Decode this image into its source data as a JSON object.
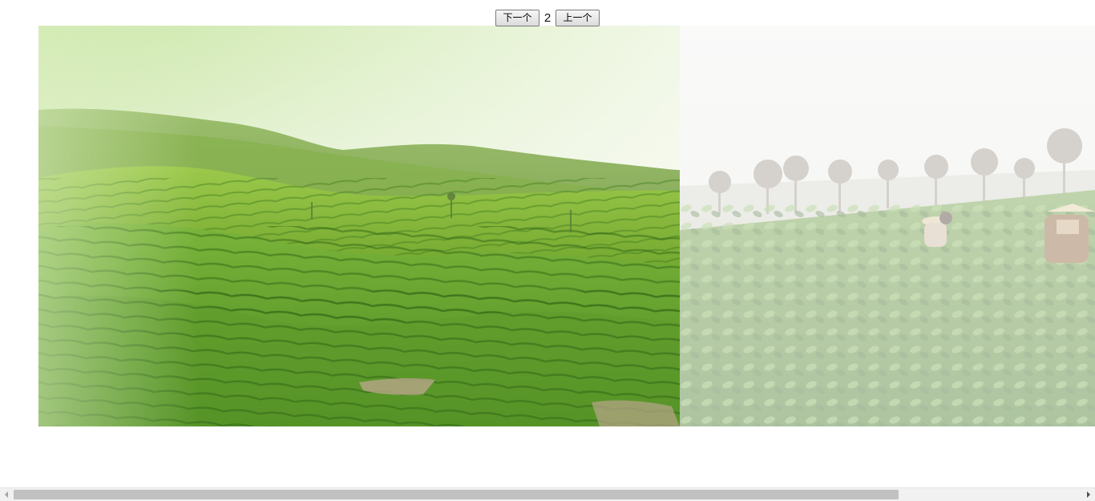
{
  "controls": {
    "next_label": "下一个",
    "counter": "2",
    "prev_label": "上一个"
  },
  "slides": [
    {
      "name": "tea-plantation-hills",
      "state": "current"
    },
    {
      "name": "tea-pickers-field",
      "state": "upcoming"
    }
  ],
  "scrollbar": {
    "left_icon": "triangle-left-icon",
    "right_icon": "triangle-right-icon"
  }
}
